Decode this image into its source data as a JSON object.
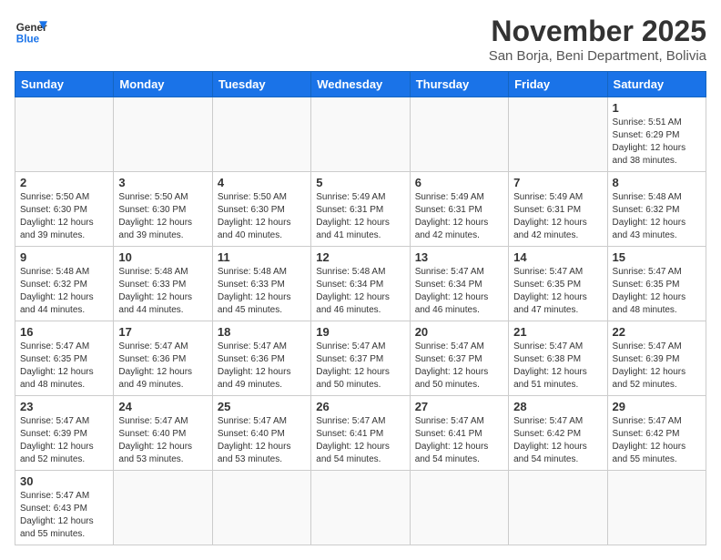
{
  "header": {
    "logo_general": "General",
    "logo_blue": "Blue",
    "month_title": "November 2025",
    "subtitle": "San Borja, Beni Department, Bolivia"
  },
  "days_of_week": [
    "Sunday",
    "Monday",
    "Tuesday",
    "Wednesday",
    "Thursday",
    "Friday",
    "Saturday"
  ],
  "weeks": [
    [
      {
        "day": "",
        "info": ""
      },
      {
        "day": "",
        "info": ""
      },
      {
        "day": "",
        "info": ""
      },
      {
        "day": "",
        "info": ""
      },
      {
        "day": "",
        "info": ""
      },
      {
        "day": "",
        "info": ""
      },
      {
        "day": "1",
        "info": "Sunrise: 5:51 AM\nSunset: 6:29 PM\nDaylight: 12 hours\nand 38 minutes."
      }
    ],
    [
      {
        "day": "2",
        "info": "Sunrise: 5:50 AM\nSunset: 6:30 PM\nDaylight: 12 hours\nand 39 minutes."
      },
      {
        "day": "3",
        "info": "Sunrise: 5:50 AM\nSunset: 6:30 PM\nDaylight: 12 hours\nand 39 minutes."
      },
      {
        "day": "4",
        "info": "Sunrise: 5:50 AM\nSunset: 6:30 PM\nDaylight: 12 hours\nand 40 minutes."
      },
      {
        "day": "5",
        "info": "Sunrise: 5:49 AM\nSunset: 6:31 PM\nDaylight: 12 hours\nand 41 minutes."
      },
      {
        "day": "6",
        "info": "Sunrise: 5:49 AM\nSunset: 6:31 PM\nDaylight: 12 hours\nand 42 minutes."
      },
      {
        "day": "7",
        "info": "Sunrise: 5:49 AM\nSunset: 6:31 PM\nDaylight: 12 hours\nand 42 minutes."
      },
      {
        "day": "8",
        "info": "Sunrise: 5:48 AM\nSunset: 6:32 PM\nDaylight: 12 hours\nand 43 minutes."
      }
    ],
    [
      {
        "day": "9",
        "info": "Sunrise: 5:48 AM\nSunset: 6:32 PM\nDaylight: 12 hours\nand 44 minutes."
      },
      {
        "day": "10",
        "info": "Sunrise: 5:48 AM\nSunset: 6:33 PM\nDaylight: 12 hours\nand 44 minutes."
      },
      {
        "day": "11",
        "info": "Sunrise: 5:48 AM\nSunset: 6:33 PM\nDaylight: 12 hours\nand 45 minutes."
      },
      {
        "day": "12",
        "info": "Sunrise: 5:48 AM\nSunset: 6:34 PM\nDaylight: 12 hours\nand 46 minutes."
      },
      {
        "day": "13",
        "info": "Sunrise: 5:47 AM\nSunset: 6:34 PM\nDaylight: 12 hours\nand 46 minutes."
      },
      {
        "day": "14",
        "info": "Sunrise: 5:47 AM\nSunset: 6:35 PM\nDaylight: 12 hours\nand 47 minutes."
      },
      {
        "day": "15",
        "info": "Sunrise: 5:47 AM\nSunset: 6:35 PM\nDaylight: 12 hours\nand 48 minutes."
      }
    ],
    [
      {
        "day": "16",
        "info": "Sunrise: 5:47 AM\nSunset: 6:35 PM\nDaylight: 12 hours\nand 48 minutes."
      },
      {
        "day": "17",
        "info": "Sunrise: 5:47 AM\nSunset: 6:36 PM\nDaylight: 12 hours\nand 49 minutes."
      },
      {
        "day": "18",
        "info": "Sunrise: 5:47 AM\nSunset: 6:36 PM\nDaylight: 12 hours\nand 49 minutes."
      },
      {
        "day": "19",
        "info": "Sunrise: 5:47 AM\nSunset: 6:37 PM\nDaylight: 12 hours\nand 50 minutes."
      },
      {
        "day": "20",
        "info": "Sunrise: 5:47 AM\nSunset: 6:37 PM\nDaylight: 12 hours\nand 50 minutes."
      },
      {
        "day": "21",
        "info": "Sunrise: 5:47 AM\nSunset: 6:38 PM\nDaylight: 12 hours\nand 51 minutes."
      },
      {
        "day": "22",
        "info": "Sunrise: 5:47 AM\nSunset: 6:39 PM\nDaylight: 12 hours\nand 52 minutes."
      }
    ],
    [
      {
        "day": "23",
        "info": "Sunrise: 5:47 AM\nSunset: 6:39 PM\nDaylight: 12 hours\nand 52 minutes."
      },
      {
        "day": "24",
        "info": "Sunrise: 5:47 AM\nSunset: 6:40 PM\nDaylight: 12 hours\nand 53 minutes."
      },
      {
        "day": "25",
        "info": "Sunrise: 5:47 AM\nSunset: 6:40 PM\nDaylight: 12 hours\nand 53 minutes."
      },
      {
        "day": "26",
        "info": "Sunrise: 5:47 AM\nSunset: 6:41 PM\nDaylight: 12 hours\nand 54 minutes."
      },
      {
        "day": "27",
        "info": "Sunrise: 5:47 AM\nSunset: 6:41 PM\nDaylight: 12 hours\nand 54 minutes."
      },
      {
        "day": "28",
        "info": "Sunrise: 5:47 AM\nSunset: 6:42 PM\nDaylight: 12 hours\nand 54 minutes."
      },
      {
        "day": "29",
        "info": "Sunrise: 5:47 AM\nSunset: 6:42 PM\nDaylight: 12 hours\nand 55 minutes."
      }
    ],
    [
      {
        "day": "30",
        "info": "Sunrise: 5:47 AM\nSunset: 6:43 PM\nDaylight: 12 hours\nand 55 minutes."
      },
      {
        "day": "",
        "info": ""
      },
      {
        "day": "",
        "info": ""
      },
      {
        "day": "",
        "info": ""
      },
      {
        "day": "",
        "info": ""
      },
      {
        "day": "",
        "info": ""
      },
      {
        "day": "",
        "info": ""
      }
    ]
  ]
}
